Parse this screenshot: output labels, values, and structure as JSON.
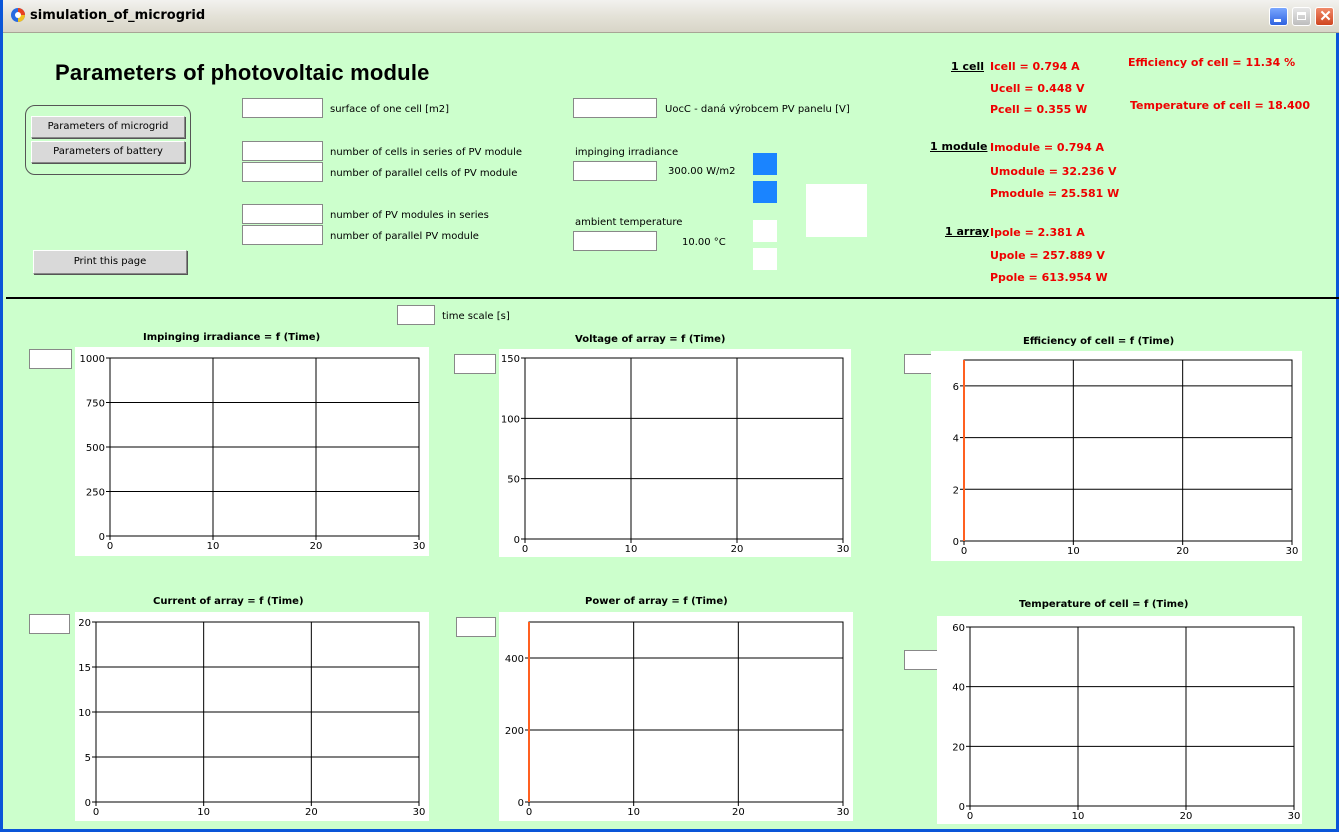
{
  "window": {
    "title": "simulation_of_microgrid"
  },
  "page": {
    "heading": "Parameters of photovoltaic module"
  },
  "buttons": {
    "microgrid": "Parameters of microgrid",
    "battery": "Parameters of battery",
    "print": "Print this page"
  },
  "labels": {
    "surface": "surface of one cell [m2]",
    "cells_series": "number of cells in series of PV module",
    "cells_parallel": "number of parallel cells of PV module",
    "modules_series": "number of PV modules in series",
    "modules_parallel": "number of parallel PV module",
    "uocc": "UocC - daná výrobcem PV panelu [V]",
    "irradiance": "impinging irradiance",
    "irradiance_value": "300.00 W/m2",
    "ambient": "ambient temperature",
    "ambient_value": "10.00 °C",
    "time_scale": "time scale [s]"
  },
  "results": {
    "cell_head": "1 cell",
    "icell": "Icell = 0.794 A",
    "ucell": "Ucell = 0.448 V",
    "pcell": "Pcell = 0.355 W",
    "module_head": "1 module",
    "imodule": "Imodule = 0.794 A",
    "umodule": "Umodule = 32.236 V",
    "pmodule": "Pmodule = 25.581 W",
    "array_head": "1 array",
    "ipole": "Ipole = 2.381 A",
    "upole": "Upole = 257.889 V",
    "ppole": "Ppole = 613.954 W",
    "efficiency": "Efficiency of cell = 11.34 %",
    "temperature": "Temperature of cell = 18.400"
  },
  "colors": {
    "background": "#ccffcc",
    "result_text": "#ee0000",
    "indicator_blue": "#1a84ff",
    "trace": "#ff6020"
  },
  "charts": [
    {
      "title": "Impinging irradiance = f (Time)",
      "xticks": [
        "0",
        "10",
        "20",
        "30"
      ],
      "yticks": [
        "0",
        "250",
        "500",
        "750",
        "1000"
      ]
    },
    {
      "title": "Voltage of array = f (Time)",
      "xticks": [
        "0",
        "10",
        "20",
        "30"
      ],
      "yticks": [
        "0",
        "50",
        "100",
        "150"
      ]
    },
    {
      "title": "Efficiency of cell = f (Time)",
      "xticks": [
        "0",
        "10",
        "20",
        "30"
      ],
      "yticks": [
        "0",
        "2",
        "4",
        "6"
      ]
    },
    {
      "title": "Current of array = f (Time)",
      "xticks": [
        "0",
        "10",
        "20",
        "30"
      ],
      "yticks": [
        "0",
        "5",
        "10",
        "15",
        "20"
      ]
    },
    {
      "title": "Power of array = f (Time)",
      "xticks": [
        "0",
        "10",
        "20",
        "30"
      ],
      "yticks": [
        "0",
        "200",
        "400"
      ]
    },
    {
      "title": "Temperature of cell = f (Time)",
      "xticks": [
        "0",
        "10",
        "20",
        "30"
      ],
      "yticks": [
        "0",
        "20",
        "40",
        "60"
      ]
    }
  ],
  "chart_data": [
    {
      "type": "line",
      "title": "Impinging irradiance = f (Time)",
      "xlabel": "",
      "ylabel": "",
      "xlim": [
        0,
        30
      ],
      "ylim": [
        0,
        1000
      ],
      "grid": true,
      "series": []
    },
    {
      "type": "line",
      "title": "Voltage of array = f (Time)",
      "xlabel": "",
      "ylabel": "",
      "xlim": [
        0,
        30
      ],
      "ylim": [
        0,
        150
      ],
      "grid": true,
      "series": []
    },
    {
      "type": "line",
      "title": "Efficiency of cell = f (Time)",
      "xlabel": "",
      "ylabel": "",
      "xlim": [
        0,
        30
      ],
      "ylim": [
        0,
        7
      ],
      "grid": true,
      "series": [
        {
          "x": [
            0,
            0
          ],
          "y": [
            0,
            7
          ]
        }
      ]
    },
    {
      "type": "line",
      "title": "Current of array = f (Time)",
      "xlabel": "",
      "ylabel": "",
      "xlim": [
        0,
        30
      ],
      "ylim": [
        0,
        20
      ],
      "grid": true,
      "series": []
    },
    {
      "type": "line",
      "title": "Power of array = f (Time)",
      "xlabel": "",
      "ylabel": "",
      "xlim": [
        0,
        30
      ],
      "ylim": [
        0,
        500
      ],
      "grid": true,
      "series": [
        {
          "x": [
            0,
            0
          ],
          "y": [
            0,
            500
          ]
        }
      ]
    },
    {
      "type": "line",
      "title": "Temperature of cell = f (Time)",
      "xlabel": "",
      "ylabel": "",
      "xlim": [
        0,
        30
      ],
      "ylim": [
        0,
        60
      ],
      "grid": true,
      "series": []
    }
  ]
}
